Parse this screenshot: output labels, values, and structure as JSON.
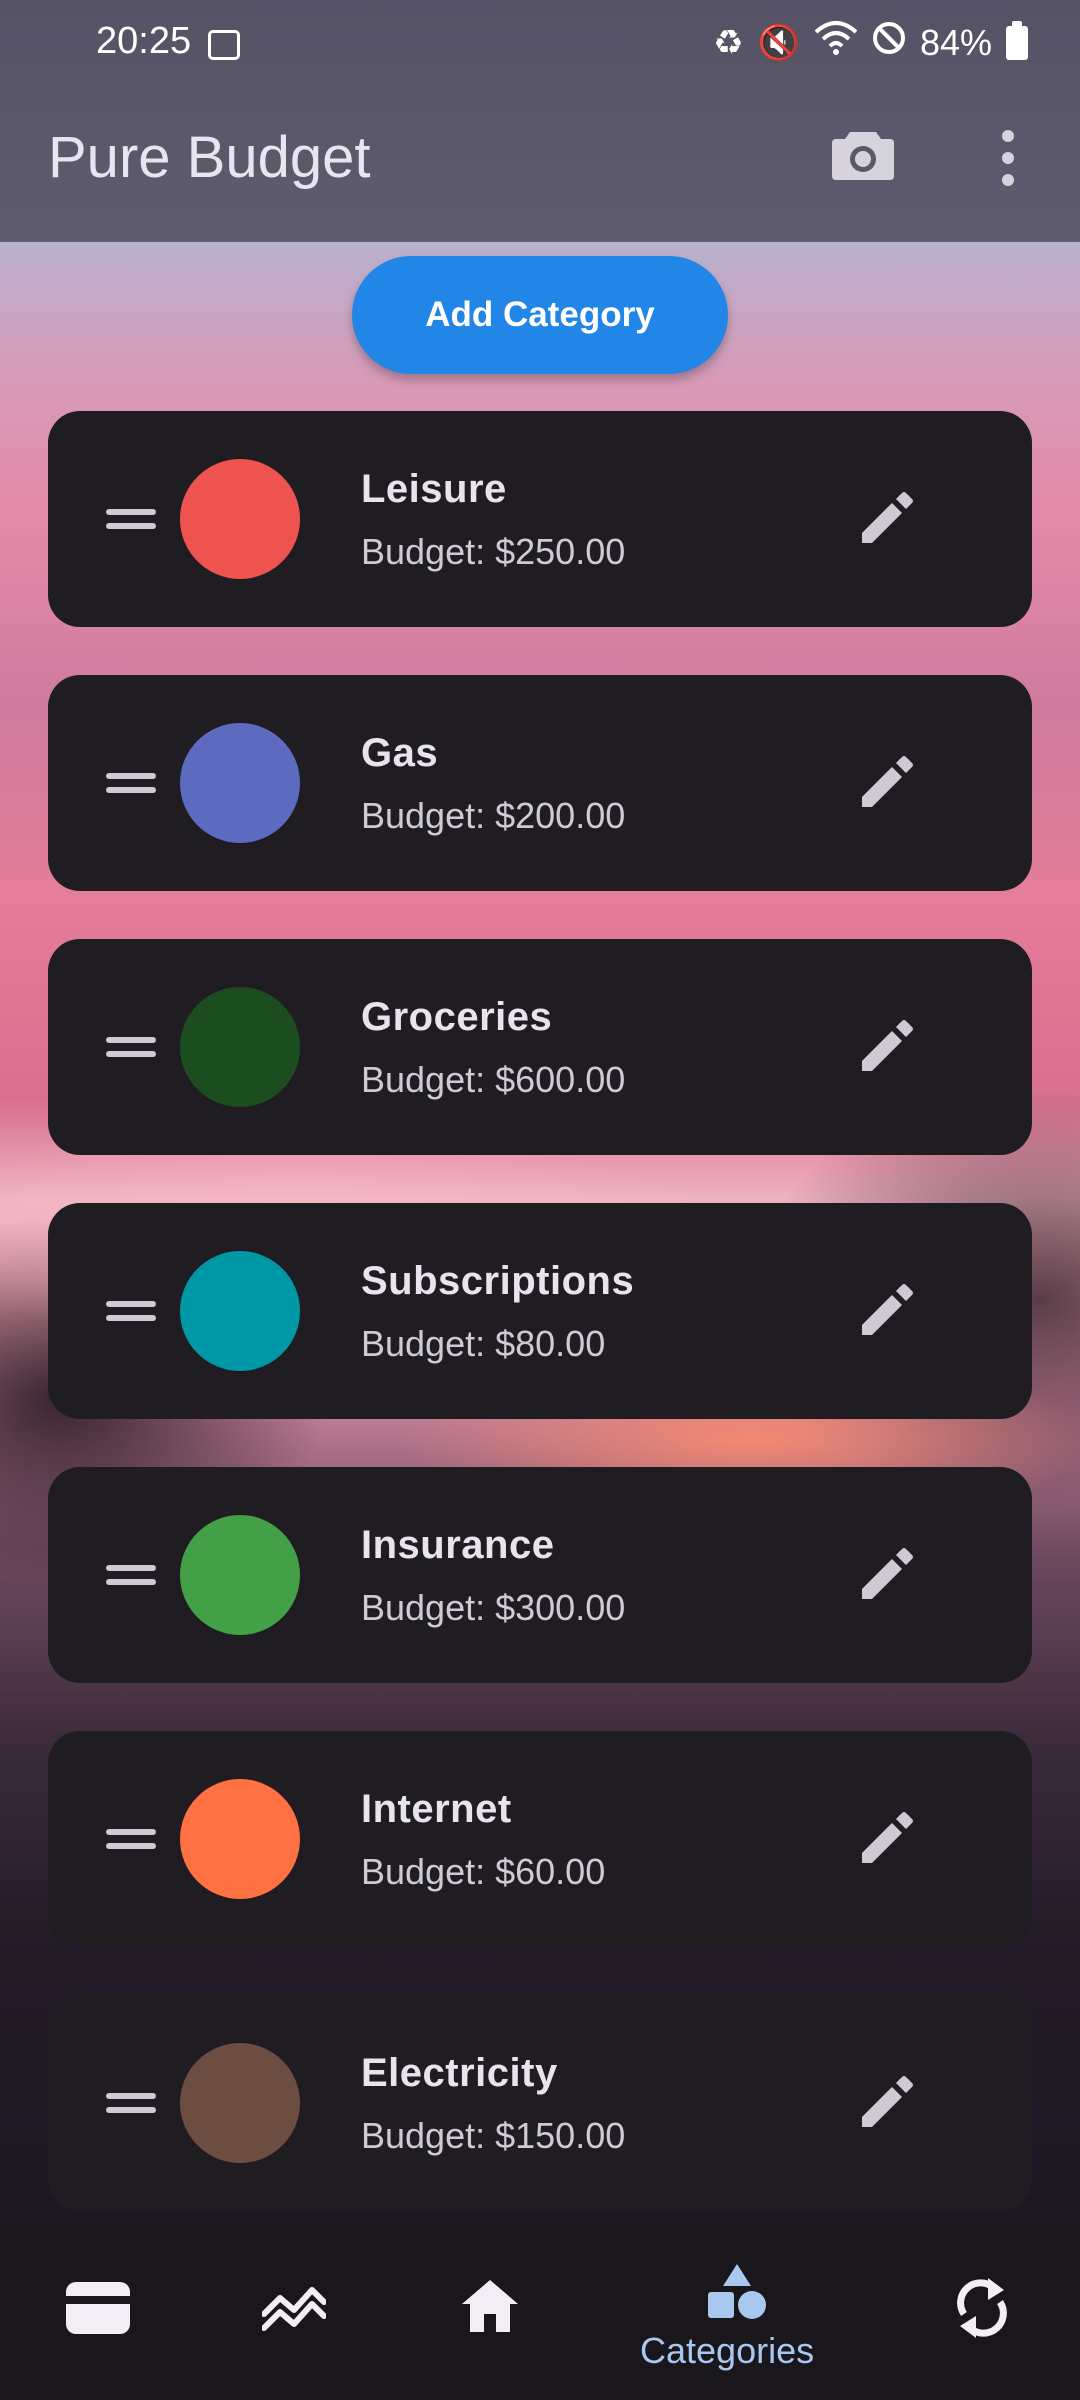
{
  "status_bar": {
    "time": "20:25",
    "battery": "84%"
  },
  "app": {
    "title": "Pure Budget",
    "camera_icon": "camera-icon",
    "more_icon": "more-vert-icon"
  },
  "actions": {
    "add_category": "Add Category"
  },
  "categories": [
    {
      "name": "Leisure",
      "budget": "Budget: $250.00",
      "color": "#ef5350"
    },
    {
      "name": "Gas",
      "budget": "Budget: $200.00",
      "color": "#5c6bc0"
    },
    {
      "name": "Groceries",
      "budget": "Budget: $600.00",
      "color": "#1b4d1e"
    },
    {
      "name": "Subscriptions",
      "budget": "Budget: $80.00",
      "color": "#0097a7"
    },
    {
      "name": "Insurance",
      "budget": "Budget: $300.00",
      "color": "#43a047"
    },
    {
      "name": "Internet",
      "budget": "Budget: $60.00",
      "color": "#ff7043"
    },
    {
      "name": "Electricity",
      "budget": "Budget: $150.00",
      "color": "#6d4c41"
    }
  ],
  "bottom_nav": {
    "items": [
      {
        "icon": "wallet-icon"
      },
      {
        "icon": "trend-icon"
      },
      {
        "icon": "home-icon"
      },
      {
        "icon": "categories-icon",
        "label": "Categories",
        "active": true
      },
      {
        "icon": "sync-icon"
      }
    ]
  },
  "colors": {
    "accent": "#2186e6",
    "active_nav": "#a8c8f0",
    "card_bg": "#1f1d22"
  }
}
